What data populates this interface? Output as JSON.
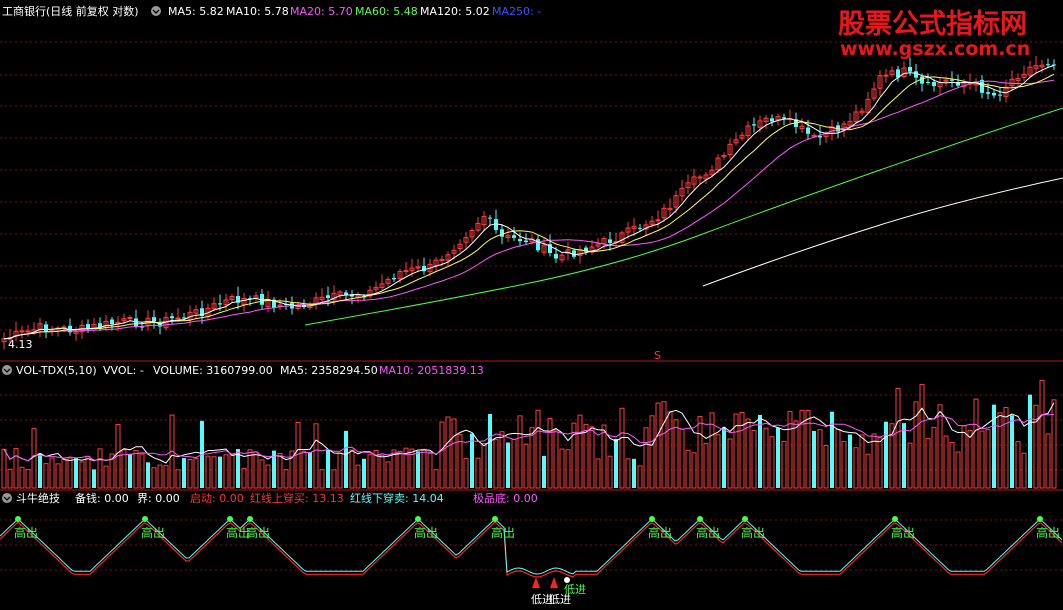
{
  "header": {
    "title": "工商银行(日线 前复权 对数)",
    "items": [
      {
        "label": "MA5: 5.82",
        "color": "#ffffff"
      },
      {
        "label": "MA10: 5.78",
        "color": "#ffffff"
      },
      {
        "label": "MA20: 5.70",
        "color": "#ff55ff"
      },
      {
        "label": "MA60: 5.48",
        "color": "#55ff55"
      },
      {
        "label": "MA120: 5.02",
        "color": "#ffffff"
      },
      {
        "label": "MA250: -",
        "color": "#3355ff"
      }
    ],
    "price_low_label": "4.13",
    "marker_label": "S"
  },
  "watermark": {
    "cn": "股票公式指标网",
    "url": "www.gszx.com.cn"
  },
  "volume_panel": {
    "title": "VOL-TDX(5,10)",
    "items": [
      {
        "label": "VVOL: -",
        "color": "#ffffff"
      },
      {
        "label": "VOLUME: 3160799.00",
        "color": "#ffffff"
      },
      {
        "label": "MA5: 2358294.50",
        "color": "#ffffff"
      },
      {
        "label": "MA10: 2051839.13",
        "color": "#ff55ff"
      }
    ]
  },
  "indicator_panel": {
    "title": "斗牛绝技",
    "items": [
      {
        "label": "备钱: 0.00",
        "color": "#ffffff"
      },
      {
        "label": "界: 0.00",
        "color": "#ffffff"
      },
      {
        "label": "启动: 0.00",
        "color": "#ff3333"
      },
      {
        "label": "红线上穿买: 13.13",
        "color": "#ff3333"
      },
      {
        "label": "红线下穿卖: 14.04",
        "color": "#55ffff"
      },
      {
        "label": "极品底: 0.00",
        "color": "#ff55ff"
      }
    ],
    "sell_label": "高出",
    "buy_label": "低进"
  },
  "colors": {
    "up": "#ff3c3c",
    "down": "#54fcfc",
    "grid": "#7a1010",
    "ma5": "#ffffff",
    "ma10": "#ffff55",
    "ma20": "#ff55ff",
    "ma60": "#44ff44",
    "ma120": "#ffffff",
    "signal_red": "#ff2020",
    "signal_cyan": "#55ffff"
  }
}
